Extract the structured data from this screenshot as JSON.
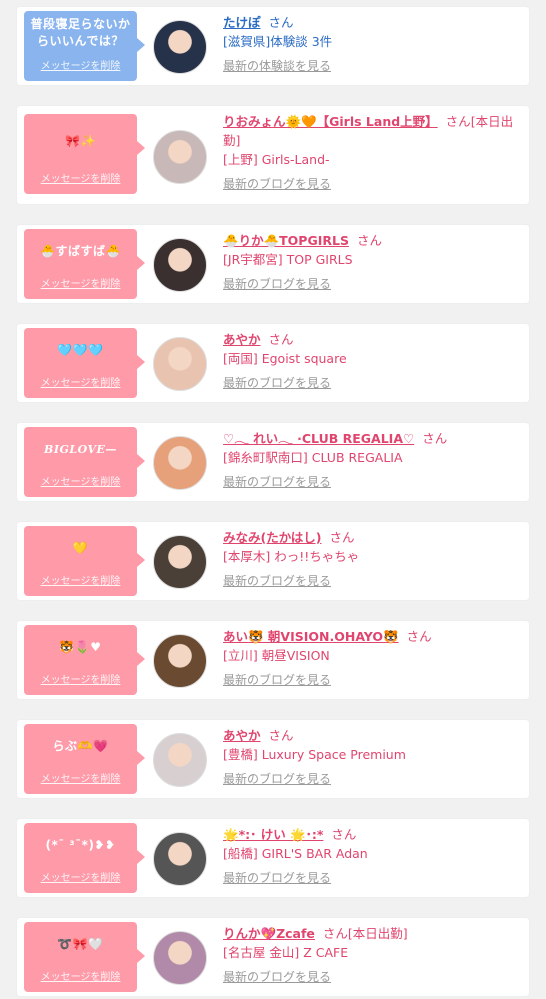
{
  "delete_label": "メッセージを削除",
  "san": "さん",
  "cards": [
    {
      "style": "blue",
      "message": "普段寝足らないか\nらいいんでは？",
      "name": "たけぽ",
      "extra": "",
      "shop": "[滋賀県]体験談 3件",
      "more": "最新の体験談を見る",
      "avatar_color": "#25324a"
    },
    {
      "style": "pink",
      "message": "🎀✨",
      "name": "りおみょん🌞🧡【Girls Land上野】",
      "extra": "[本日出勤]",
      "shop": "[上野] Girls-Land-",
      "more": "最新のブログを見る",
      "avatar_color": "#c8b8b8"
    },
    {
      "style": "pink",
      "message": "🐣すばすば🐣",
      "name": "🐣りか🐣TOPGIRLS",
      "extra": "",
      "shop": "[JR宇都宮] TOP GIRLS",
      "more": "最新のブログを見る",
      "avatar_color": "#3a3030"
    },
    {
      "style": "pink",
      "message": "🩵🩵🩵",
      "name": "あやか",
      "extra": "",
      "shop": "[両国] Egoist square",
      "more": "最新のブログを見る",
      "avatar_color": "#e8c4b0"
    },
    {
      "style": "pink script",
      "message": "BIGLOVE—",
      "name": "♡𓂃 れい𓂃 ·CLUB REGALIA♡",
      "extra": "",
      "shop": "[錦糸町駅南口] CLUB REGALIA",
      "more": "最新のブログを見る",
      "avatar_color": "#e6a07a"
    },
    {
      "style": "pink",
      "message": "💛",
      "name": "みなみ(たかはし)",
      "extra": "",
      "shop": "[本厚木] わっ!!ちゃちゃ",
      "more": "最新のブログを見る",
      "avatar_color": "#4a4038"
    },
    {
      "style": "pink",
      "message": "🐯🌷♥",
      "name": "あい🐯 朝VISION.OHAYO🐯",
      "extra": "",
      "shop": "[立川] 朝昼VISION",
      "more": "最新のブログを見る",
      "avatar_color": "#6a4a30"
    },
    {
      "style": "pink",
      "message": "らぶ🫶💗",
      "name": "あやか",
      "extra": "",
      "shop": "[豊橋] Luxury Space Premium",
      "more": "最新のブログを見る",
      "avatar_color": "#d8d0d0"
    },
    {
      "style": "pink",
      "message": "(*¯ ³¯*)❥❥",
      "name": "🌟*:･ けい 🌟･:*",
      "extra": "",
      "shop": "[船橋] GIRL'S BAR Adan",
      "more": "最新のブログを見る",
      "avatar_color": "#555"
    },
    {
      "style": "pink",
      "message": "➰🎀🤍",
      "name": "りんか💖Zcafe",
      "extra": "[本日出勤]",
      "shop": "[名古屋 金山] Z CAFE",
      "more": "最新のブログを見る",
      "avatar_color": "#b08aa8"
    }
  ]
}
